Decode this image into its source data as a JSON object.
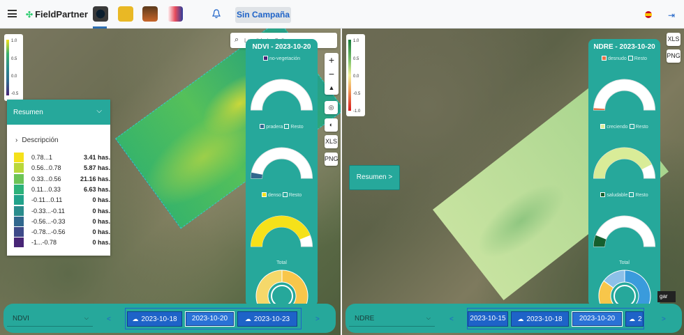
{
  "header": {
    "app_name": "FieldPartner",
    "campaign_label": "Sin Campaña",
    "logout_icon": "logout-icon",
    "language_icon": "flag-es-icon"
  },
  "left_map": {
    "legend_ticks": [
      "1.0",
      "0.5",
      "0.0",
      "-0.5"
    ],
    "resumen": {
      "title": "Resumen",
      "description_label": "Descripción",
      "rows": [
        {
          "range": "0.78...1",
          "value": "3.41 has.",
          "color": "#f5e11a"
        },
        {
          "range": "0.56...0.78",
          "value": "5.87 has.",
          "color": "#b9d73a"
        },
        {
          "range": "0.33...0.56",
          "value": "21.16 has.",
          "color": "#6cc456"
        },
        {
          "range": "0.11...0.33",
          "value": "6.63 has.",
          "color": "#2db27a"
        },
        {
          "range": "-0.11...0.11",
          "value": "0 has.",
          "color": "#21a28a"
        },
        {
          "range": "-0.33...-0.11",
          "value": "0 has.",
          "color": "#2a8c8c"
        },
        {
          "range": "-0.56...-0.33",
          "value": "0 has.",
          "color": "#31688e"
        },
        {
          "range": "-0.78...-0.56",
          "value": "0 has.",
          "color": "#3e4a89"
        },
        {
          "range": "-1...-0.78",
          "value": "0 has.",
          "color": "#482576"
        }
      ]
    },
    "search": {
      "placeholder": "Localidad o Calle"
    },
    "chart_panel": {
      "title": "NDVI - 2023-10-20",
      "gauges": [
        {
          "label": "no-vegetación",
          "rest": "",
          "fraction": 0.0,
          "color": "#482576"
        },
        {
          "label": "pradera",
          "rest": "Resto",
          "fraction": 0.06,
          "color": "#31688e"
        },
        {
          "label": "denso",
          "rest": "Resto",
          "fraction": 0.88,
          "color": "#f5e11a"
        }
      ],
      "total_label": "Total"
    },
    "controls": {
      "xls": "XLS",
      "png": "PNG"
    },
    "bottom": {
      "layer": "NDVI",
      "prev": "<",
      "next": ">",
      "dates": [
        "2023-10-18",
        "2023-10-20",
        "2023-10-23"
      ],
      "active_date": "2023-10-20"
    }
  },
  "right_map": {
    "legend_ticks": [
      "1.0",
      "0.5",
      "0.0",
      "-0.5",
      "-1.0"
    ],
    "resumen_button": "Resumen >",
    "chart_panel": {
      "title": "NDRE - 2023-10-20",
      "gauges": [
        {
          "label": "desnudo",
          "rest": "Resto",
          "fraction": 0.02,
          "color": "#e8734a"
        },
        {
          "label": "creciendo",
          "rest": "Resto",
          "fraction": 0.85,
          "color": "#d9ec98"
        },
        {
          "label": "saludable",
          "rest": "Resto",
          "fraction": 0.12,
          "color": "#155f2e"
        }
      ],
      "total_label": "Total"
    },
    "controls": {
      "xls": "XLS",
      "png": "PNG"
    },
    "overlay": "gar",
    "bottom": {
      "layer": "NDRE",
      "prev": "<",
      "next": ">",
      "dates": [
        "2023-10-15",
        "2023-10-18",
        "2023-10-20",
        "2"
      ],
      "active_date": "2023-10-20"
    }
  },
  "colors": {
    "teal": "#26a89b",
    "blue": "#1e63c8"
  }
}
